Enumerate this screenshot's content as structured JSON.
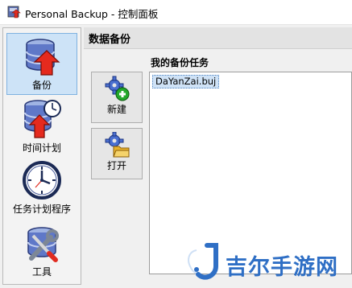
{
  "window": {
    "title": "Personal Backup - 控制面板",
    "icon": "app-backup-icon"
  },
  "sidebar": {
    "items": [
      {
        "label": "备份",
        "icon": "backup-database-icon",
        "selected": true
      },
      {
        "label": "时间计划",
        "icon": "schedule-database-clock-icon",
        "selected": false
      },
      {
        "label": "任务计划程序",
        "icon": "clock-icon",
        "selected": false
      },
      {
        "label": "工具",
        "icon": "tools-icon",
        "selected": false
      }
    ]
  },
  "main": {
    "title": "数据备份",
    "buttons": [
      {
        "label": "新建",
        "icon": "new-task-gear-plus-icon"
      },
      {
        "label": "打开",
        "icon": "open-task-gear-folder-icon"
      }
    ],
    "tasks_label": "我的备份任务",
    "tasks": [
      "DaYanZai.buj"
    ]
  },
  "watermark": {
    "text": "吉尔手游网",
    "color": "#2f6fc5"
  },
  "colors": {
    "selection": "#cde3f7",
    "accent": "#2f6fc5"
  }
}
